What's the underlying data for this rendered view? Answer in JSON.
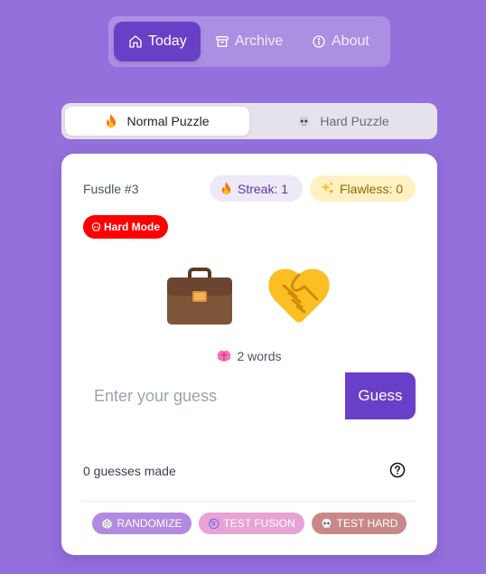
{
  "nav": {
    "items": [
      {
        "label": "Today",
        "icon": "home-icon",
        "active": true
      },
      {
        "label": "Archive",
        "icon": "archive-icon",
        "active": false
      },
      {
        "label": "About",
        "icon": "info-icon",
        "active": false
      }
    ]
  },
  "mode_switch": {
    "normal_label": "Normal Puzzle",
    "normal_icon": "fire-icon",
    "hard_label": "Hard Puzzle",
    "hard_icon": "skull-icon",
    "selected": "Normal Puzzle"
  },
  "card": {
    "puzzle_number": "Fusdle #3",
    "streak_label": "Streak: 1",
    "flawless_label": "Flawless: 0",
    "hard_mode_label": "Hard Mode",
    "emojis": [
      "briefcase-emoji",
      "handshake-emoji"
    ],
    "hint": "2 words",
    "guess_placeholder": "Enter your guess",
    "guess_button": "Guess",
    "guess_count": "0 guesses made",
    "tools": {
      "randomize": "RANDOMIZE",
      "test_fusion": "TEST FUSION",
      "test_hard": "TEST HARD"
    }
  },
  "colors": {
    "background": "#9370db",
    "accent": "#6a3fc8",
    "hard_badge": "#ff0000"
  }
}
